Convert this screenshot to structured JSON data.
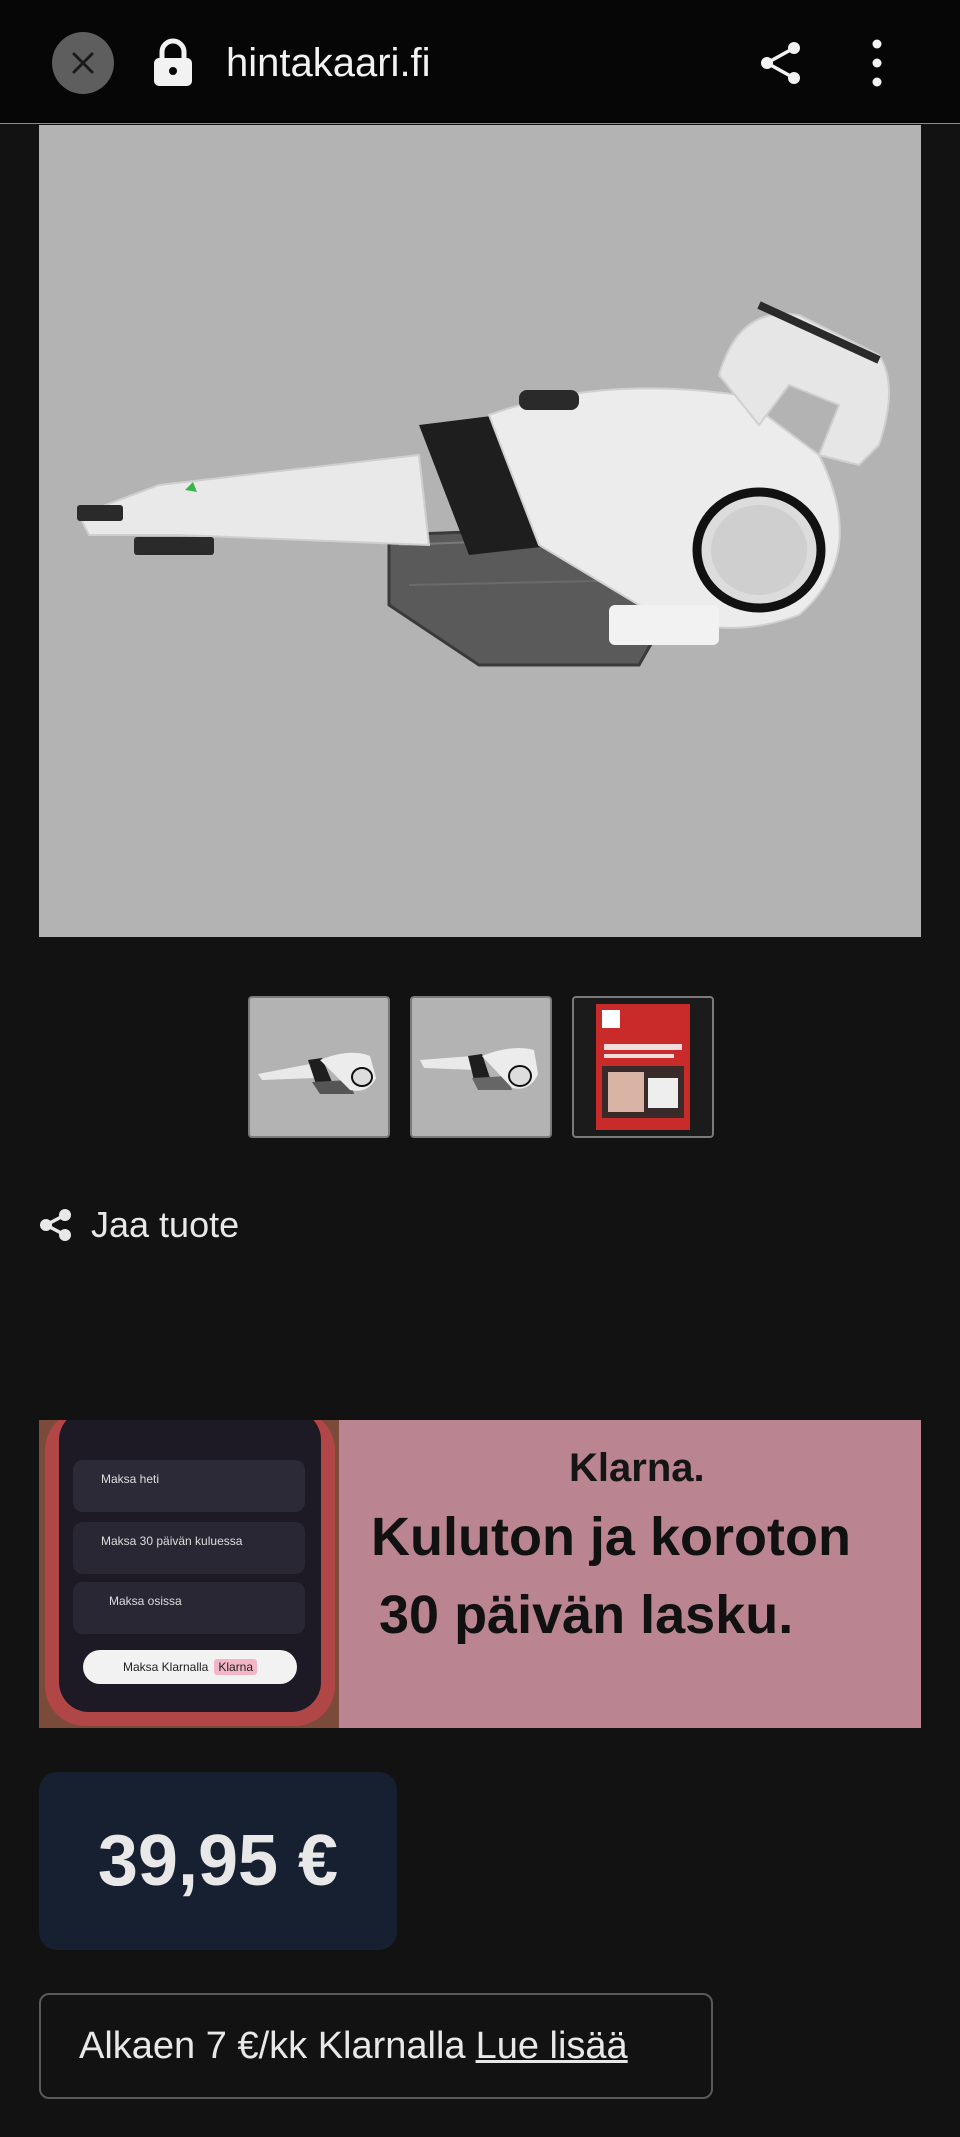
{
  "browser": {
    "url": "hintakaari.fi",
    "icons": {
      "close": "close-icon",
      "lock": "lock-icon",
      "share": "share-icon",
      "menu": "more-vert-icon"
    }
  },
  "product": {
    "main_image": "handheld vacuum cleaner (white/black)",
    "thumbnails": [
      "vacuum side view",
      "vacuum side view 2",
      "product box"
    ],
    "share_label": "Jaa tuote"
  },
  "klarna_banner": {
    "logo": "Klarna.",
    "headline_1": "Kuluton ja koroton",
    "headline_2": "30 päivän lasku.",
    "phone": {
      "option_1": "Maksa heti",
      "option_2": "Maksa 30 päivän kuluessa",
      "option_3": "Maksa osissa",
      "pay_button": "Maksa Klarnalla",
      "pay_badge": "Klarna"
    }
  },
  "price": {
    "value": "39,95 €"
  },
  "klarna_info": {
    "text": "Alkaen 7 €/kk Klarnalla",
    "link": "Lue lisää"
  },
  "colors": {
    "banner_bg": "#ba8590",
    "price_bg": "#172030",
    "page_bg": "#121212"
  }
}
